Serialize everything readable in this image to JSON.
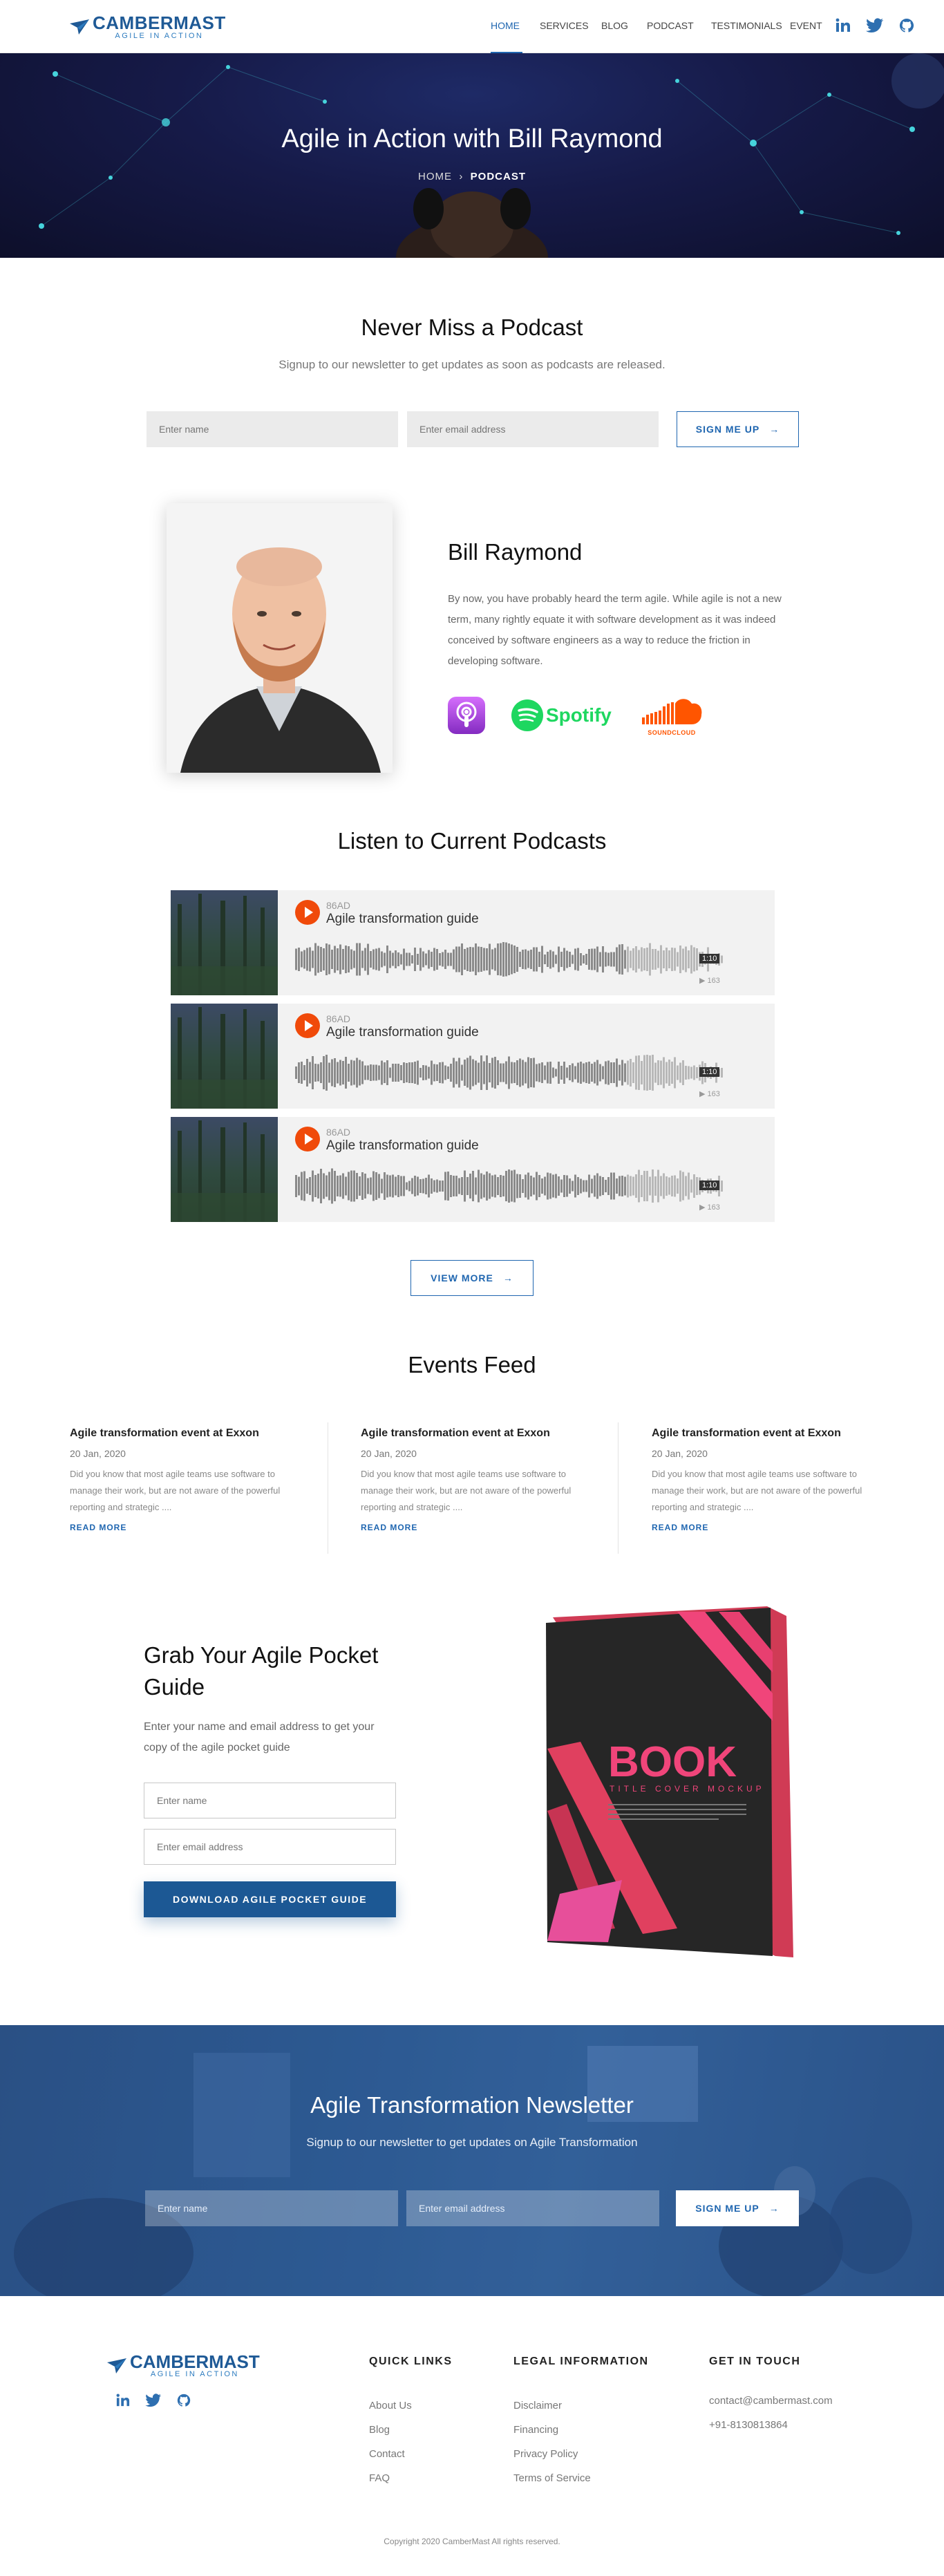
{
  "header": {
    "logo_name": "CAMBERMAST",
    "logo_tagline": "AGILE IN ACTION",
    "nav": [
      "HOME",
      "SERVICES",
      "BLOG",
      "PODCAST",
      "TESTIMONIALS",
      "EVENT"
    ],
    "social_icons": [
      "linkedin-icon",
      "twitter-icon",
      "github-icon"
    ],
    "accent_color": "#1f66b0"
  },
  "hero": {
    "title": "Agile in Action with Bill Raymond",
    "crumb_home": "HOME",
    "crumb_sep": "›",
    "crumb_current": "PODCAST"
  },
  "signup": {
    "title": "Never Miss a Podcast",
    "subtitle": "Signup to our newsletter to get updates as soon as podcasts are released.",
    "name_placeholder": "Enter name",
    "email_placeholder": "Enter email address",
    "button": "SIGN ME UP"
  },
  "bio": {
    "name": "Bill Raymond",
    "text": "By now, you have probably heard the term agile. While agile is not a new term, many rightly equate it with software development as it was indeed conceived by software engineers as a way to reduce the friction in developing software.",
    "platforms": {
      "spotify": "Spotify",
      "soundcloud": "SOUNDCLOUD"
    }
  },
  "podcasts": {
    "title": "Listen to Current Podcasts",
    "items": [
      {
        "user": "86AD",
        "title": "Agile transformation guide",
        "duration": "1:10",
        "plays": "163"
      },
      {
        "user": "86AD",
        "title": "Agile transformation guide",
        "duration": "1:10",
        "plays": "163"
      },
      {
        "user": "86AD",
        "title": "Agile transformation guide",
        "duration": "1:10",
        "plays": "163"
      }
    ],
    "view_more": "VIEW MORE"
  },
  "events": {
    "title": "Events Feed",
    "items": [
      {
        "title": "Agile transformation event at Exxon",
        "date": "20 Jan, 2020",
        "desc": "Did you know that most agile teams use software to manage their work, but are not aware of the powerful reporting and strategic ....",
        "more": "READ MORE"
      },
      {
        "title": "Agile transformation event at Exxon",
        "date": "20 Jan, 2020",
        "desc": "Did you know that most agile teams use software to manage their work, but are not aware of the powerful reporting and strategic ....",
        "more": "READ MORE"
      },
      {
        "title": "Agile transformation event at Exxon",
        "date": "20 Jan, 2020",
        "desc": "Did you know that most agile teams use software to manage their work, but are not aware of the powerful reporting and strategic ....",
        "more": "READ MORE"
      }
    ]
  },
  "guide": {
    "title": "Grab Your Agile Pocket Guide",
    "text": "Enter your name and email address to get your copy of the agile pocket guide",
    "name_placeholder": "Enter name",
    "email_placeholder": "Enter email address",
    "button": "DOWNLOAD AGILE POCKET GUIDE",
    "book_title": "BOOK",
    "book_subtitle": "TITLE COVER MOCKUP"
  },
  "newsletter": {
    "title": "Agile Transformation Newsletter",
    "subtitle": "Signup to our newsletter to get updates on Agile Transformation",
    "name_placeholder": "Enter name",
    "email_placeholder": "Enter email address",
    "button": "SIGN ME UP"
  },
  "footer": {
    "quick_links_title": "QUICK LINKS",
    "quick_links": [
      "About Us",
      "Blog",
      "Contact",
      "FAQ"
    ],
    "legal_title": "LEGAL INFORMATION",
    "legal_links": [
      "Disclaimer",
      "Financing",
      "Privacy Policy",
      "Terms of Service"
    ],
    "contact_title": "GET IN TOUCH",
    "email": "contact@cambermast.com",
    "phone": "+91-8130813864",
    "copyright": "Copyright 2020 CamberMast All rights reserved."
  }
}
